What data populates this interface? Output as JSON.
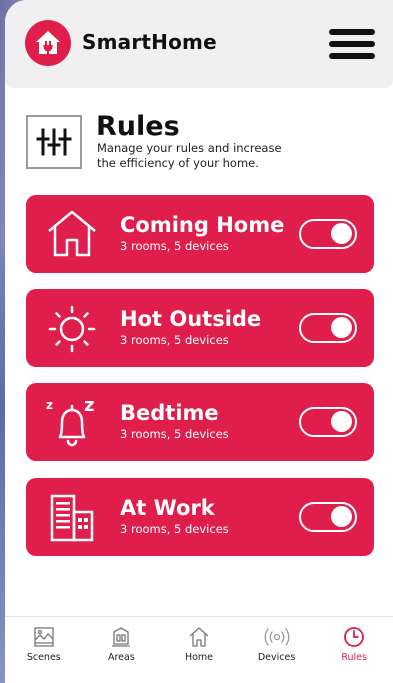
{
  "header": {
    "app_title": "SmartHome",
    "logo_icon": "house-plug-icon",
    "menu_icon": "hamburger-icon"
  },
  "page": {
    "title": "Rules",
    "subtitle": "Manage your rules and increase the efficiency of your home.",
    "icon": "sliders-icon"
  },
  "rules": [
    {
      "name": "Coming Home",
      "meta": "3 rooms, 5 devices",
      "icon": "house-icon",
      "enabled": true
    },
    {
      "name": "Hot Outside",
      "meta": "3 rooms, 5 devices",
      "icon": "sun-icon",
      "enabled": true
    },
    {
      "name": "Bedtime",
      "meta": "3 rooms, 5 devices",
      "icon": "bell-sleep-icon",
      "enabled": true
    },
    {
      "name": "At Work",
      "meta": "3 rooms, 5 devices",
      "icon": "building-icon",
      "enabled": true
    }
  ],
  "tabs": [
    {
      "label": "Scenes",
      "icon": "scenes-icon",
      "active": false
    },
    {
      "label": "Areas",
      "icon": "areas-icon",
      "active": false
    },
    {
      "label": "Home",
      "icon": "home-icon",
      "active": false
    },
    {
      "label": "Devices",
      "icon": "wireless-icon",
      "active": false
    },
    {
      "label": "Rules",
      "icon": "clock-icon",
      "active": true
    }
  ],
  "colors": {
    "accent": "#e01e4c",
    "header_bg": "#f0f0f0",
    "text": "#111111"
  }
}
